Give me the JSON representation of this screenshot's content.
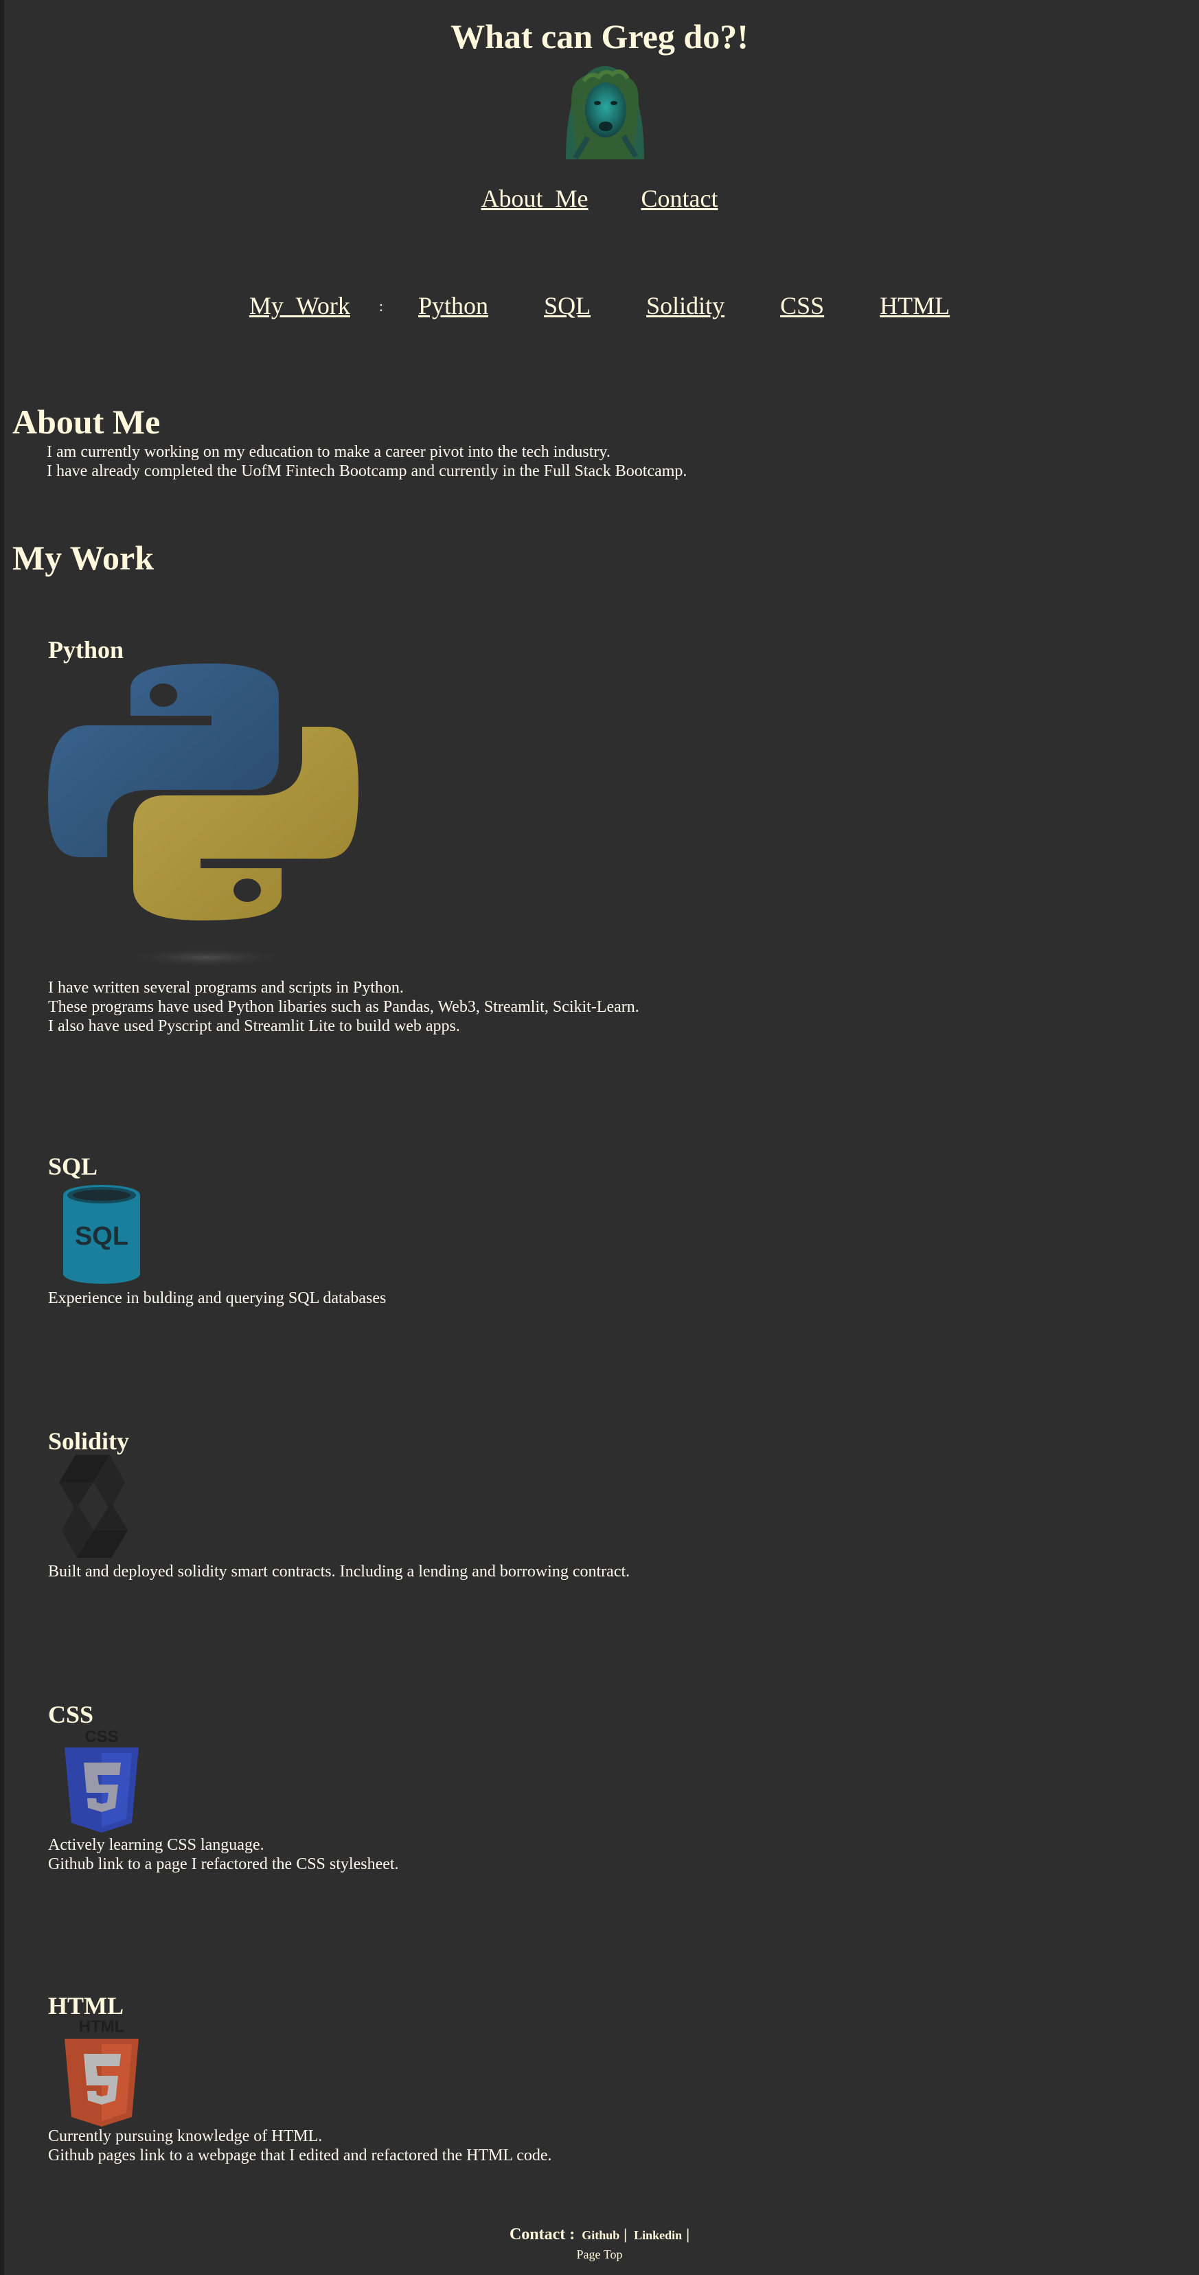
{
  "header": {
    "title": "What can Greg do?!",
    "avatar_icon": "avatar-portrait"
  },
  "nav": {
    "about": "About_Me",
    "contact": "Contact"
  },
  "work_nav": {
    "my_work": "My_Work",
    "separator": ":",
    "items": [
      "Python",
      "SQL",
      "Solidity",
      "CSS",
      "HTML"
    ]
  },
  "about": {
    "heading": "About Me",
    "lines": [
      "I am currently working on my education to make a career pivot into the tech industry.",
      "I have already completed the UofM Fintech Bootcamp and currently in the Full Stack Bootcamp."
    ]
  },
  "my_work": {
    "heading": "My Work",
    "cards": [
      {
        "title": "Python",
        "icon": "python-logo-icon",
        "lines": [
          "I have written several programs and scripts in Python.",
          "These programs have used Python libaries such as Pandas, Web3, Streamlit, Scikit-Learn.",
          "I also have used Pyscript and Streamlit Lite to build web apps."
        ]
      },
      {
        "title": "SQL",
        "icon": "sql-database-icon",
        "lines": [
          "Experience in bulding and querying SQL databases"
        ]
      },
      {
        "title": "Solidity",
        "icon": "solidity-logo-icon",
        "lines": [
          "Built and deployed solidity smart contracts. Including a lending and borrowing contract."
        ]
      },
      {
        "title": "CSS",
        "icon": "css3-logo-icon",
        "lines": [
          "Actively learning CSS language.",
          "Github link to a page I refactored the CSS stylesheet."
        ]
      },
      {
        "title": "HTML",
        "icon": "html5-logo-icon",
        "lines": [
          "Currently pursuing knowledge of HTML.",
          "Github pages link to a webpage that I edited and refactored the HTML code."
        ]
      }
    ]
  },
  "footer": {
    "label": "Contact :",
    "github": "Github",
    "linkedin": "Linkedin",
    "pipe": "|",
    "page_top": "Page Top"
  },
  "colors": {
    "background": "#2e2e2e",
    "text": "#fff8dc",
    "python_blue": "#2f4f6f",
    "python_yellow": "#a8903a",
    "sql_teal": "#1a7f9c",
    "css_blue": "#2e44a8",
    "html_orange": "#b44a2c"
  }
}
